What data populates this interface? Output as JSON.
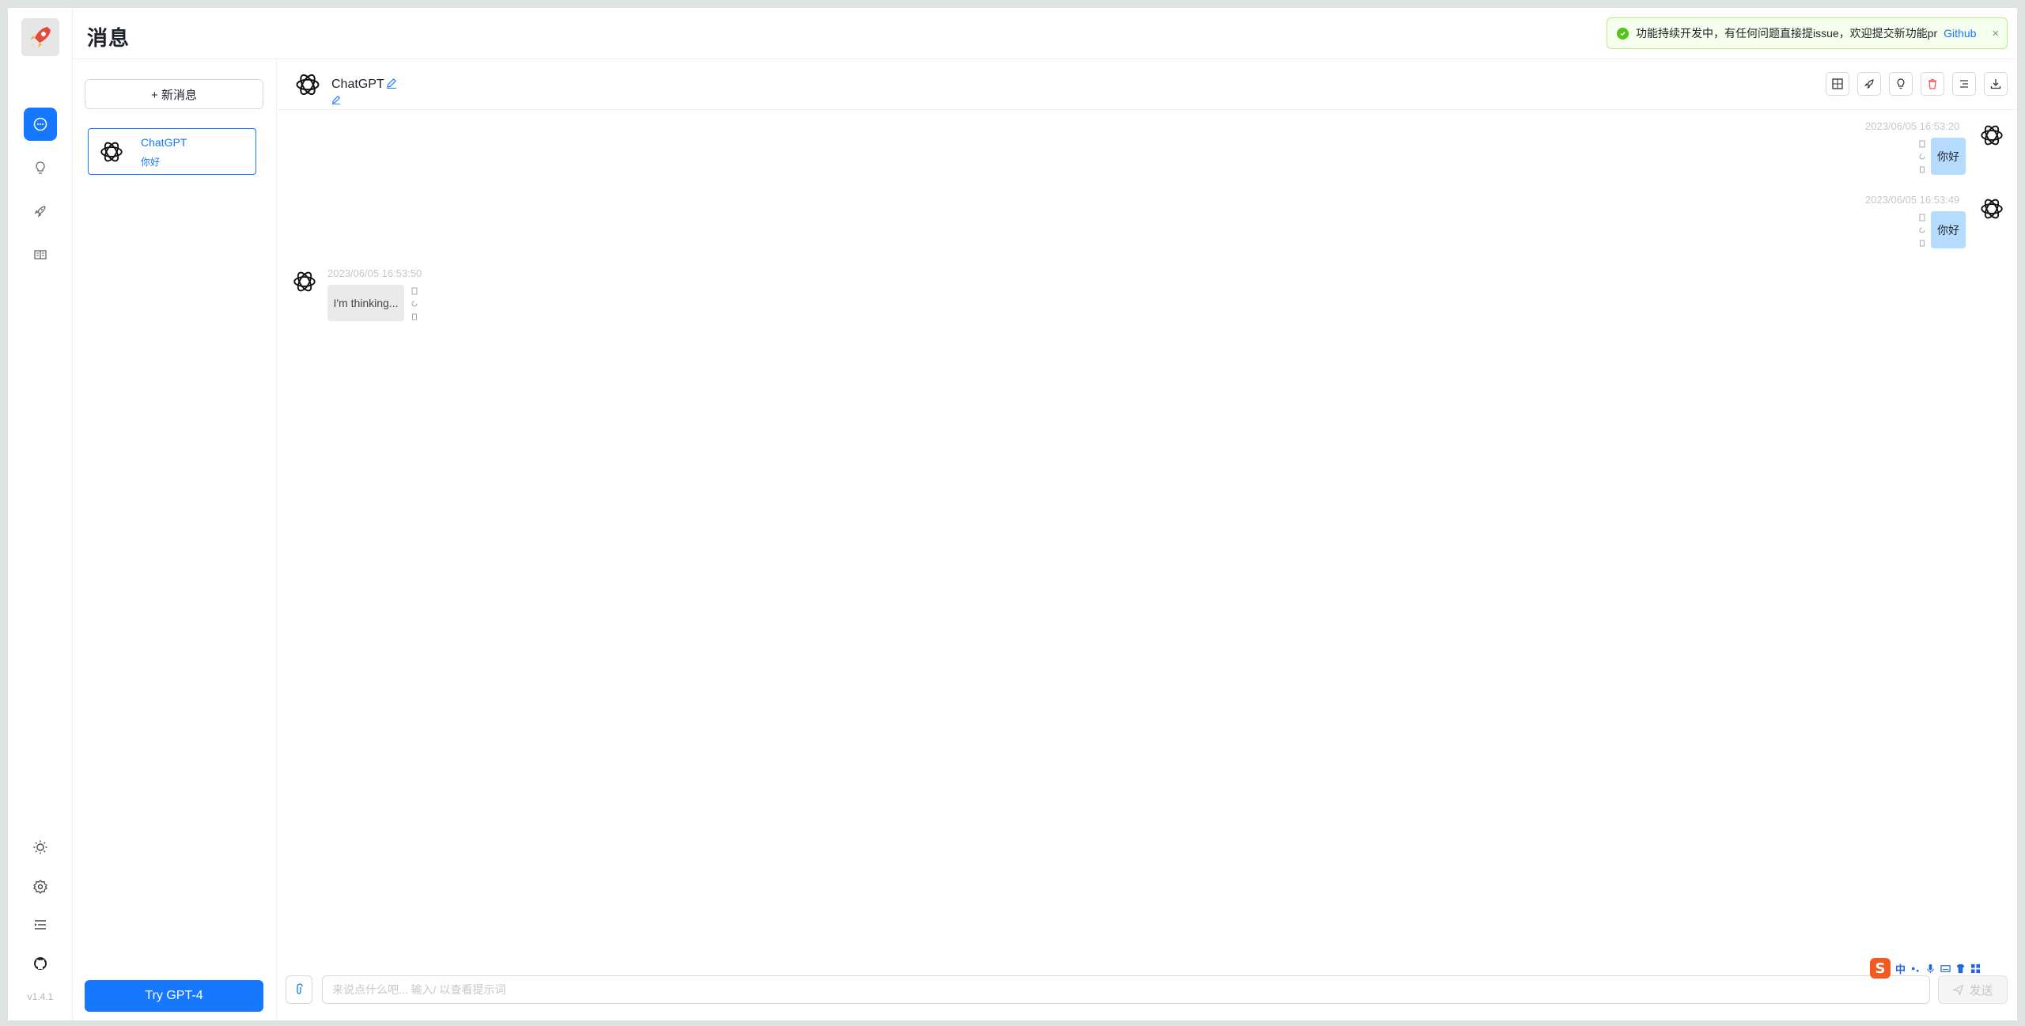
{
  "app": {
    "page_title": "消息",
    "version": "v1.4.1"
  },
  "notice": {
    "text": "功能持续开发中，有任何问题直接提issue，欢迎提交新功能pr",
    "link": "Github",
    "close": "×"
  },
  "rail": {
    "items": [
      {
        "name": "chat",
        "active": true
      },
      {
        "name": "bulb",
        "active": false
      },
      {
        "name": "rocket",
        "active": false
      },
      {
        "name": "book",
        "active": false
      }
    ],
    "bottom": [
      "sun",
      "settings",
      "menu",
      "github"
    ]
  },
  "sessions": {
    "new_label": "+ 新消息",
    "items": [
      {
        "name": "ChatGPT",
        "preview": "你好"
      }
    ],
    "gpt4_label": "Try GPT-4"
  },
  "chat": {
    "title": "ChatGPT",
    "messages": [
      {
        "role": "user",
        "time": "2023/06/05 16:53:20",
        "text": "你好"
      },
      {
        "role": "user",
        "time": "2023/06/05 16:53:49",
        "text": "你好"
      },
      {
        "role": "assistant",
        "time": "2023/06/05 16:53:50",
        "text": "I'm thinking..."
      }
    ]
  },
  "input": {
    "placeholder": "来说点什么吧... 输入/ 以查看提示词",
    "value": "",
    "send_label": "发送"
  },
  "ime": {
    "logo": "S",
    "lang": "中"
  },
  "colors": {
    "accent": "#1677ff",
    "user_bubble": "#b5dcff",
    "bot_bubble": "#eaeaea",
    "success": "#52c41a"
  }
}
